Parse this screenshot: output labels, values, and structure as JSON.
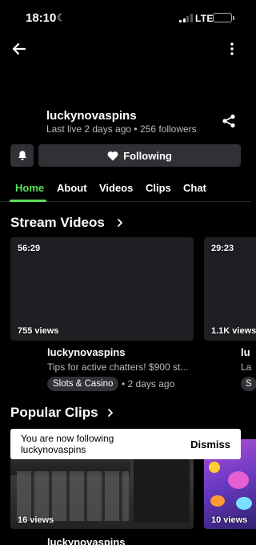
{
  "status_bar": {
    "time": "18:10",
    "network": "LTE",
    "battery_level": "41"
  },
  "profile": {
    "username": "luckynovaspins",
    "last_live": "Last live 2 days ago",
    "followers": "256 followers",
    "follow_label": "Following"
  },
  "tabs": [
    "Home",
    "About",
    "Videos",
    "Clips",
    "Chat"
  ],
  "active_tab": "Home",
  "stream_videos": {
    "title": "Stream Videos",
    "items": [
      {
        "duration": "56:29",
        "views": "755 views",
        "channel": "luckynovaspins",
        "description": "Tips for active chatters! $900 st...",
        "category": "Slots & Casino",
        "date": "2 days ago"
      },
      {
        "duration": "29:23",
        "views": "1.1K views",
        "channel": "lu",
        "description": "La",
        "category": "S",
        "date": ""
      }
    ]
  },
  "popular_clips": {
    "title": "Popular Clips",
    "items": [
      {
        "views": "16 views",
        "channel": "luckynovaspins"
      },
      {
        "views": "10 views",
        "channel": ""
      }
    ]
  },
  "toast": {
    "message": "You are now following luckynovaspins",
    "action": "Dismiss"
  },
  "colors": {
    "accent": "#5ce05c",
    "background": "#000000",
    "surface": "#303035"
  }
}
